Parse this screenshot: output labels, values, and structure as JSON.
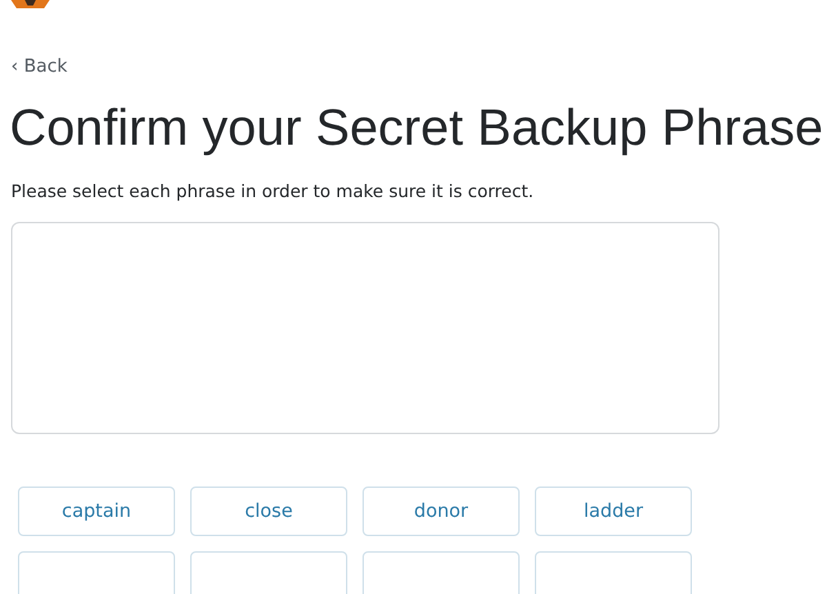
{
  "back_link": "‹ Back",
  "title": "Confirm your Secret Backup Phrase",
  "instructions": "Please select each phrase in order to make sure it is correct.",
  "words": [
    {
      "kind": "word",
      "label": "captain"
    },
    {
      "kind": "word",
      "label": "close"
    },
    {
      "kind": "word",
      "label": "donor"
    },
    {
      "kind": "word",
      "label": "ladder"
    },
    {
      "kind": "cut_off"
    },
    {
      "kind": "cut_off"
    },
    {
      "kind": "cut_off"
    },
    {
      "kind": "cut_off"
    }
  ]
}
